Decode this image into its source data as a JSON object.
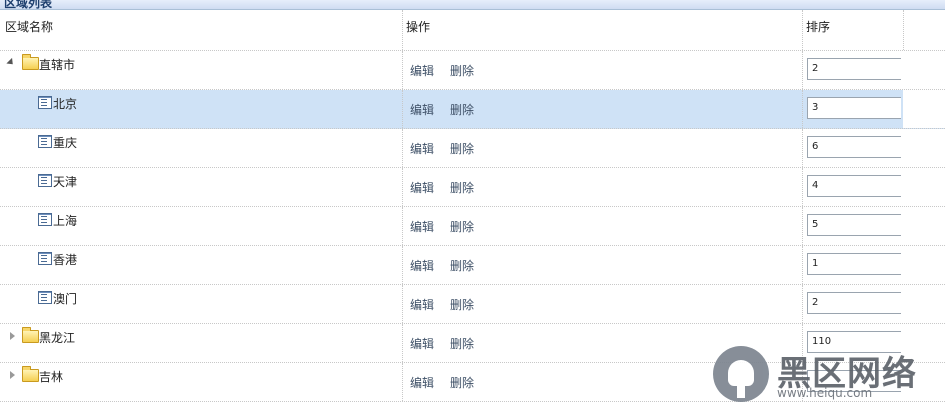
{
  "panel": {
    "title": "区域列表"
  },
  "columns": {
    "name": "区域名称",
    "ops": "操作",
    "sort": "排序"
  },
  "actions": {
    "edit": "编辑",
    "delete": "删除"
  },
  "rows": [
    {
      "name": "直辖市",
      "type": "folder",
      "expanded": true,
      "sort": "2",
      "selected": false
    },
    {
      "name": "北京",
      "type": "leaf",
      "sort": "3",
      "selected": true
    },
    {
      "name": "重庆",
      "type": "leaf",
      "sort": "6",
      "selected": false
    },
    {
      "name": "天津",
      "type": "leaf",
      "sort": "4",
      "selected": false
    },
    {
      "name": "上海",
      "type": "leaf",
      "sort": "5",
      "selected": false
    },
    {
      "name": "香港",
      "type": "leaf",
      "sort": "1",
      "selected": false
    },
    {
      "name": "澳门",
      "type": "leaf",
      "sort": "2",
      "selected": false
    },
    {
      "name": "黑龙江",
      "type": "folder",
      "expanded": false,
      "sort": "110",
      "selected": false
    },
    {
      "name": "吉林",
      "type": "folder",
      "expanded": false,
      "sort": "",
      "selected": false
    }
  ],
  "watermark": {
    "text": "黑区网络",
    "url": "www.heiqu.com"
  },
  "colors": {
    "selected_row": "#cfe2f6",
    "header_bar": "#d8e4f5"
  }
}
